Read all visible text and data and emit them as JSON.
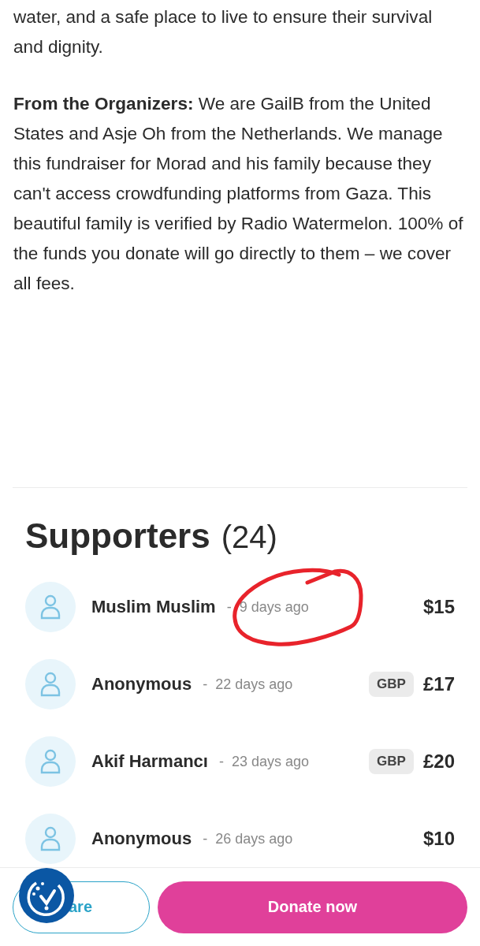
{
  "story": {
    "paragraphs": [
      {
        "text": "water, and a safe place to live to ensure their survival and dignity."
      },
      {
        "text": "**From the Organizers:** We are GailB from the United States and Asje Oh from the Netherlands. We manage this fundraiser for Morad and his family because they can't access crowdfunding platforms from Gaza. This beautiful family is verified by Radio Watermelon. 100% of the funds you donate will go directly to them – we cover all fees."
      }
    ]
  },
  "supporters": {
    "title": "Supporters",
    "count": "(24)",
    "items": [
      {
        "name": "Muslim Muslim",
        "separator": "-",
        "time": "9 days ago",
        "amount": "$15"
      },
      {
        "name": "Anonymous",
        "separator": "-",
        "time": "22 days ago",
        "currency": "GBP",
        "amount": "£17"
      },
      {
        "name": "Akif Harmancı",
        "separator": "-",
        "time": "23 days ago",
        "currency": "GBP",
        "amount": "£20"
      },
      {
        "name": "Anonymous",
        "separator": "-",
        "time": "26 days ago",
        "amount": "$10"
      }
    ]
  },
  "footer": {
    "share": "are",
    "donate": "Donate now"
  }
}
